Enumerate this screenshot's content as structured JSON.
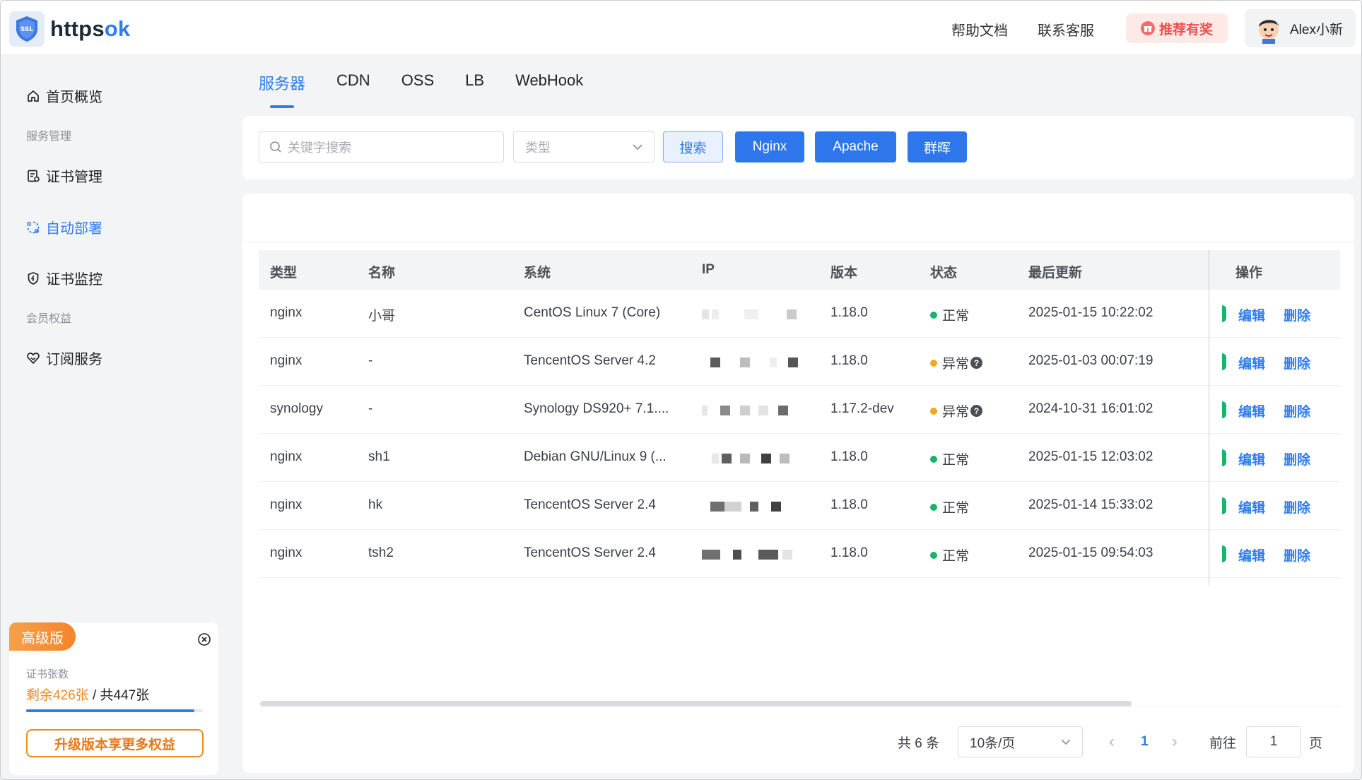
{
  "header": {
    "logo_main": "https",
    "logo_accent": "ok",
    "logo_badge": "SSL",
    "help_docs": "帮助文档",
    "contact": "联系客服",
    "promo": "推荐有奖",
    "user_name": "Alex小新"
  },
  "sidebar": {
    "items": [
      {
        "label": "首页概览",
        "icon": "home-icon"
      },
      {
        "group": "服务管理"
      },
      {
        "label": "证书管理",
        "icon": "certificate-icon"
      },
      {
        "label": "自动部署",
        "icon": "deploy-icon",
        "active": true
      },
      {
        "label": "证书监控",
        "icon": "shield-monitor-icon"
      },
      {
        "group": "会员权益"
      },
      {
        "label": "订阅服务",
        "icon": "heart-subscribe-icon"
      }
    ],
    "plan": {
      "badge": "高级版",
      "cert_label": "证书张数",
      "remaining": "剩余426张",
      "separator": " / ",
      "total": "共447张",
      "progress": 0.953,
      "upgrade_button": "升级版本享更多权益"
    }
  },
  "tabs": [
    "服务器",
    "CDN",
    "OSS",
    "LB",
    "WebHook"
  ],
  "filters": {
    "search_placeholder": "关键字搜索",
    "type_placeholder": "类型",
    "search_button": "搜索",
    "buttons": [
      "Nginx",
      "Apache",
      "群晖"
    ]
  },
  "table": {
    "headers": [
      "类型",
      "名称",
      "系统",
      "IP",
      "版本",
      "状态",
      "最后更新",
      "操作"
    ],
    "rows": [
      {
        "type": "nginx",
        "name": "小哥",
        "system": "CentOS Linux 7 (Core)",
        "version": "1.18.0",
        "status": "正常",
        "status_kind": "ok",
        "updated": "2025-01-15 10:22:02"
      },
      {
        "type": "nginx",
        "name": "-",
        "system": "TencentOS Server 4.2",
        "version": "1.18.0",
        "status": "异常",
        "status_kind": "warn",
        "updated": "2025-01-03 00:07:19"
      },
      {
        "type": "synology",
        "name": "-",
        "system": "Synology DS920+ 7.1....",
        "version": "1.17.2-dev",
        "status": "异常",
        "status_kind": "warn",
        "updated": "2024-10-31 16:01:02"
      },
      {
        "type": "nginx",
        "name": "sh1",
        "system": "Debian GNU/Linux 9 (...",
        "version": "1.18.0",
        "status": "正常",
        "status_kind": "ok",
        "updated": "2025-01-15 12:03:02"
      },
      {
        "type": "nginx",
        "name": "hk",
        "system": "TencentOS Server 2.4",
        "version": "1.18.0",
        "status": "正常",
        "status_kind": "ok",
        "updated": "2025-01-14 15:33:02"
      },
      {
        "type": "nginx",
        "name": "tsh2",
        "system": "TencentOS Server 2.4",
        "version": "1.18.0",
        "status": "正常",
        "status_kind": "ok",
        "updated": "2025-01-15 09:54:03"
      }
    ],
    "edit_label": "编辑",
    "delete_label": "删除",
    "status_help": "?"
  },
  "pagination": {
    "total": "共 6 条",
    "page_size": "10条/页",
    "current_page": "1",
    "goto_label": "前往",
    "goto_value": "1",
    "page_suffix": "页",
    "prev": "‹",
    "next": "›"
  },
  "colors": {
    "primary": "#2f7cf0",
    "ok": "#19b36b",
    "warn": "#f5a623",
    "accent_orange": "#f08a22"
  }
}
